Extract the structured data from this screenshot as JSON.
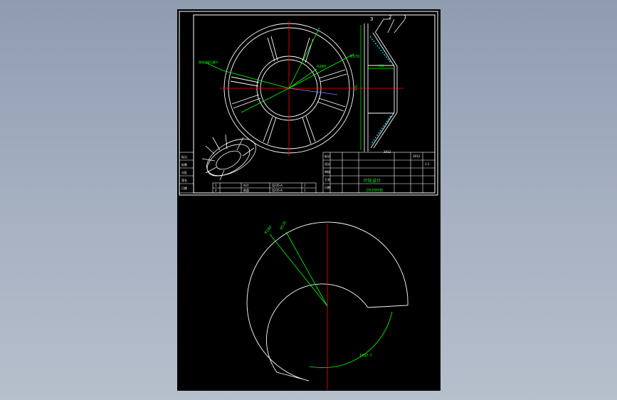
{
  "title_block": {
    "drawing_title": "叶轮设计",
    "drawing_subtitle": "D570叶轮",
    "row_labels": [
      "标记",
      "设计",
      "审核",
      "工艺",
      "日期"
    ],
    "code_a": "2012",
    "code_b": "1:1",
    "left_column": [
      "标记",
      "处数",
      "分区",
      "签名",
      "日期"
    ]
  },
  "bom": {
    "row1": [
      "1",
      "叶片",
      "1",
      "Q235-A",
      "",
      "1"
    ],
    "row2": [
      "2",
      "前盘",
      "1",
      "Q235-A",
      "",
      "1"
    ]
  },
  "dims": {
    "outer_radius": "R570",
    "inner_radius": "R280",
    "arc_length": "1097.7",
    "leader_note": "焊接成型后磨平",
    "width_dim": "190",
    "height_dim": "570"
  },
  "colors": {
    "sheet": "#000000",
    "line": "#ffffff",
    "centerline": "#ff0000",
    "dimension": "#00ff00",
    "background": "#9aa6b8"
  }
}
